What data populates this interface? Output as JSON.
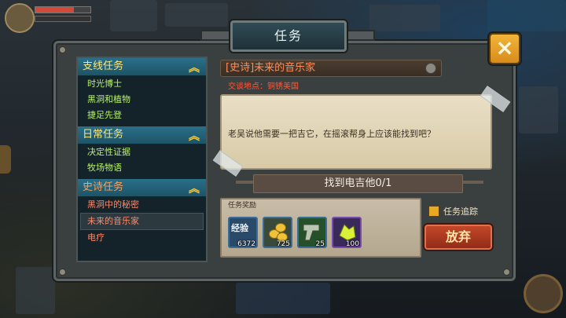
{
  "dialog": {
    "title": "任务",
    "close_icon": "×"
  },
  "quest_list": {
    "categories": [
      {
        "label": "支线任务",
        "items": [
          "时光博士",
          "黑洞和植物",
          "捷足先登"
        ]
      },
      {
        "label": "日常任务",
        "items": [
          "决定性证据",
          "牧场物语"
        ]
      },
      {
        "label": "史诗任务",
        "items": [
          "黑洞中的秘密",
          "未来的音乐家",
          "电疗"
        ]
      }
    ],
    "selected": "未来的音乐家",
    "chevron_icon": "chevron-up-icon"
  },
  "detail": {
    "title": "[史诗]未来的音乐家",
    "location": "交谈地点：铜锈美国",
    "description": "老吴说他需要一把吉它，在摇滚帮身上应该能找到吧？",
    "objective": "找到电吉他0/1",
    "rewards_label": "任务奖励",
    "rewards": [
      {
        "icon": "exp-icon",
        "label": "经验",
        "count": "6372"
      },
      {
        "icon": "gold-coins-icon",
        "count": "725"
      },
      {
        "icon": "weapon-part-icon",
        "count": "25"
      },
      {
        "icon": "yellow-crystal-icon",
        "count": "100"
      }
    ],
    "track_label": "任务追踪",
    "abandon_label": "放弃"
  },
  "colors": {
    "category_header": "#2a6f88",
    "side_quest_text": "#b8f26a",
    "epic_text": "#ff8a6a",
    "abandon_button": "#c64a2a",
    "close_button": "#f2b43a"
  }
}
